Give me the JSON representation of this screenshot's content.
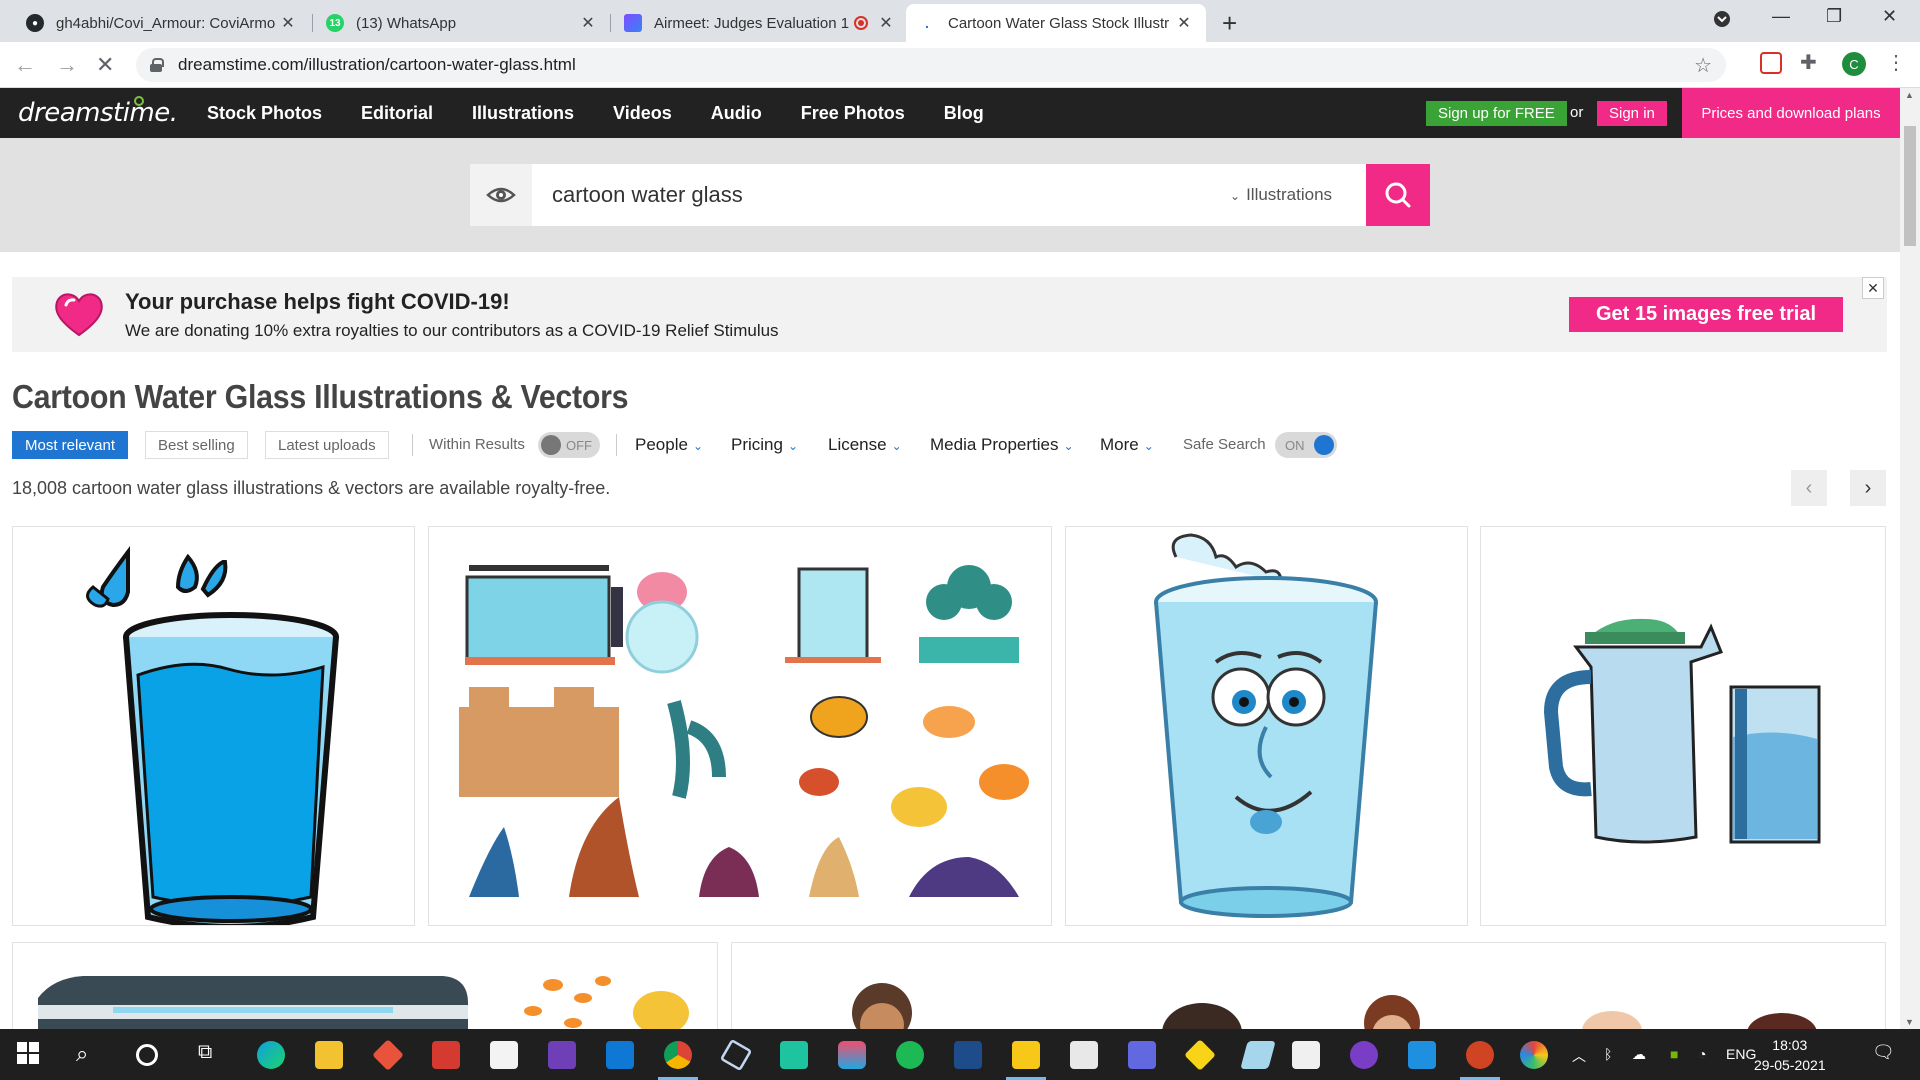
{
  "browser": {
    "tabs": [
      {
        "title": "gh4abhi/Covi_Armour: CoviArmo",
        "favicon": "github-icon"
      },
      {
        "title": "(13) WhatsApp",
        "favicon": "whatsapp-icon",
        "badge": "13"
      },
      {
        "title": "Airmeet: Judges Evaluation 1",
        "favicon": "airmeet-icon"
      },
      {
        "title": "Cartoon Water Glass Stock Illustr",
        "favicon": "dreamstime-icon",
        "active": true
      }
    ],
    "url": "dreamstime.com/illustration/cartoon-water-glass.html",
    "profile_initial": "C"
  },
  "site": {
    "logo": "dreamstime.",
    "nav": [
      "Stock Photos",
      "Editorial",
      "Illustrations",
      "Videos",
      "Audio",
      "Free Photos",
      "Blog"
    ],
    "signup": "Sign up for FREE",
    "or": "or",
    "signin": "Sign in",
    "prices": "Prices and download plans",
    "colors": {
      "pink": "#f02a86",
      "green": "#3aa335",
      "blue": "#1f76d2",
      "dark": "#222222"
    }
  },
  "search": {
    "query": "cartoon water glass",
    "category": "Illustrations"
  },
  "banner": {
    "title": "Your purchase helps fight COVID-19!",
    "text": "We are donating 10% extra royalties to our contributors as a COVID-19 Relief Stimulus",
    "cta": "Get 15 images free trial",
    "close": "✕"
  },
  "page": {
    "title": "Cartoon Water Glass Illustrations & Vectors",
    "sort": [
      "Most relevant",
      "Best selling",
      "Latest uploads"
    ],
    "within_results": "Within Results",
    "within_state": "OFF",
    "filters": [
      "People",
      "Pricing",
      "License",
      "Media Properties",
      "More"
    ],
    "safe_search": "Safe Search",
    "safe_state": "ON",
    "count_text": "18,008 cartoon water glass illustrations & vectors are available royalty-free."
  },
  "taskbar": {
    "lang": "ENG",
    "time": "18:03",
    "date": "29-05-2021"
  }
}
